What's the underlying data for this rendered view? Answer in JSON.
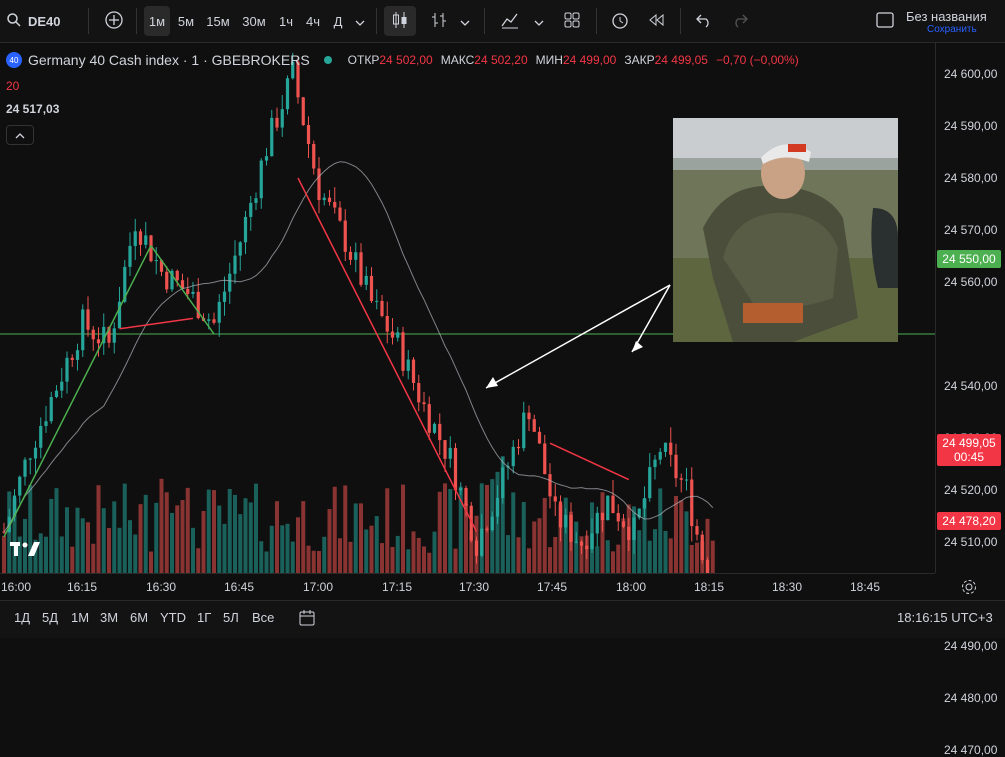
{
  "toolbar": {
    "symbol": "DE40",
    "add_symbol_icon": "plus-circle-icon",
    "intervals": [
      "1м",
      "5м",
      "15м",
      "30м",
      "1ч",
      "4ч",
      "Д"
    ],
    "active_interval": "1м",
    "layout_title": "Без названия",
    "layout_status": "Сохранить"
  },
  "legend": {
    "badge": "40",
    "title": "Germany 40 Cash index · 1 · GBEBROKERS",
    "open_label": "ОТКР",
    "open": "24 502,00",
    "high_label": "МАКС",
    "high": "24 502,20",
    "low_label": "МИН",
    "low": "24 499,00",
    "close_label": "ЗАКР",
    "close": "24 499,05",
    "change": "−0,70 (−0,00%)",
    "ma_period": "20",
    "ma_value": "24 517,03"
  },
  "price_tags": {
    "last": "24 499,05",
    "countdown": "00:45",
    "hline_green": "24 550,00",
    "hline_red": "24 478,20"
  },
  "bottom": {
    "ranges": [
      "1Д",
      "5Д",
      "1М",
      "3М",
      "6М",
      "YTD",
      "1Г",
      "5Л",
      "Все"
    ],
    "clock": "18:16:15 UTC+3"
  },
  "chart_data": {
    "type": "candlestick",
    "title": "Germany 40 Cash index · 1 · GBEBROKERS",
    "x_ticks": [
      "16:00",
      "16:15",
      "16:30",
      "16:45",
      "17:00",
      "17:15",
      "17:30",
      "17:45",
      "18:00",
      "18:15",
      "18:30",
      "18:45"
    ],
    "y_ticks": [
      "24 600,00",
      "24 590,00",
      "24 580,00",
      "24 570,00",
      "24 560,00",
      "24 550,00",
      "24 540,00",
      "24 530,00",
      "24 520,00",
      "24 510,00",
      "24 490,00",
      "24 480,00",
      "24 470,00"
    ],
    "ylim": [
      24465,
      24605
    ],
    "series": [
      {
        "name": "close",
        "x": [
          "16:00",
          "16:05",
          "16:10",
          "16:15",
          "16:20",
          "16:25",
          "16:30",
          "16:35",
          "16:40",
          "16:45",
          "16:50",
          "16:55",
          "17:00",
          "17:05",
          "17:10",
          "17:15",
          "17:20",
          "17:25",
          "17:30",
          "17:35",
          "17:40",
          "17:45",
          "17:50",
          "17:55",
          "18:00",
          "18:05",
          "18:10",
          "18:15"
        ],
        "values": [
          24512,
          24528,
          24540,
          24552,
          24548,
          24572,
          24562,
          24558,
          24552,
          24568,
          24586,
          24600,
          24578,
          24568,
          24556,
          24548,
          24536,
          24526,
          24510,
          24522,
          24536,
          24515,
          24510,
          24518,
          24512,
          24528,
          24520,
          24499
        ]
      }
    ],
    "hlines": [
      24550.0,
      24478.2
    ],
    "last_price": 24499.05
  },
  "colors": {
    "up": "#26a69a",
    "down": "#ef5350",
    "green_line": "#4caf50",
    "red_line": "#f23645"
  }
}
